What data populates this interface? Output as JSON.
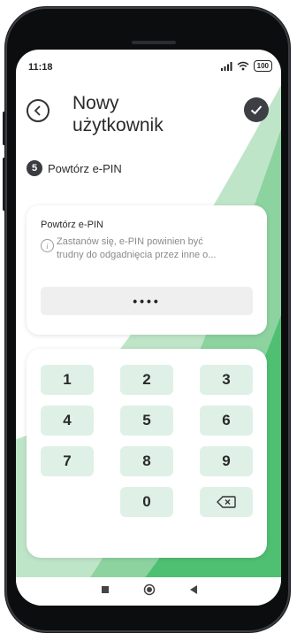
{
  "status_bar": {
    "time": "11:18",
    "battery": "100"
  },
  "header": {
    "title_line1": "Nowy",
    "title_line2": "użytkownik"
  },
  "step": {
    "number": "5",
    "label": "Powtórz e-PIN"
  },
  "pin_card": {
    "title": "Powtórz e-PIN",
    "hint_line1": "Zastanów się, e-PIN powinien być",
    "hint_line2": "trudny do odgadnięcia przez inne o...",
    "value": "••••"
  },
  "keypad": {
    "k1": "1",
    "k2": "2",
    "k3": "3",
    "k4": "4",
    "k5": "5",
    "k6": "6",
    "k7": "7",
    "k8": "8",
    "k9": "9",
    "k0": "0"
  },
  "colors": {
    "accent_green": "#3dbb65",
    "key_bg": "#dff1e6",
    "dark": "#3d3f44"
  }
}
